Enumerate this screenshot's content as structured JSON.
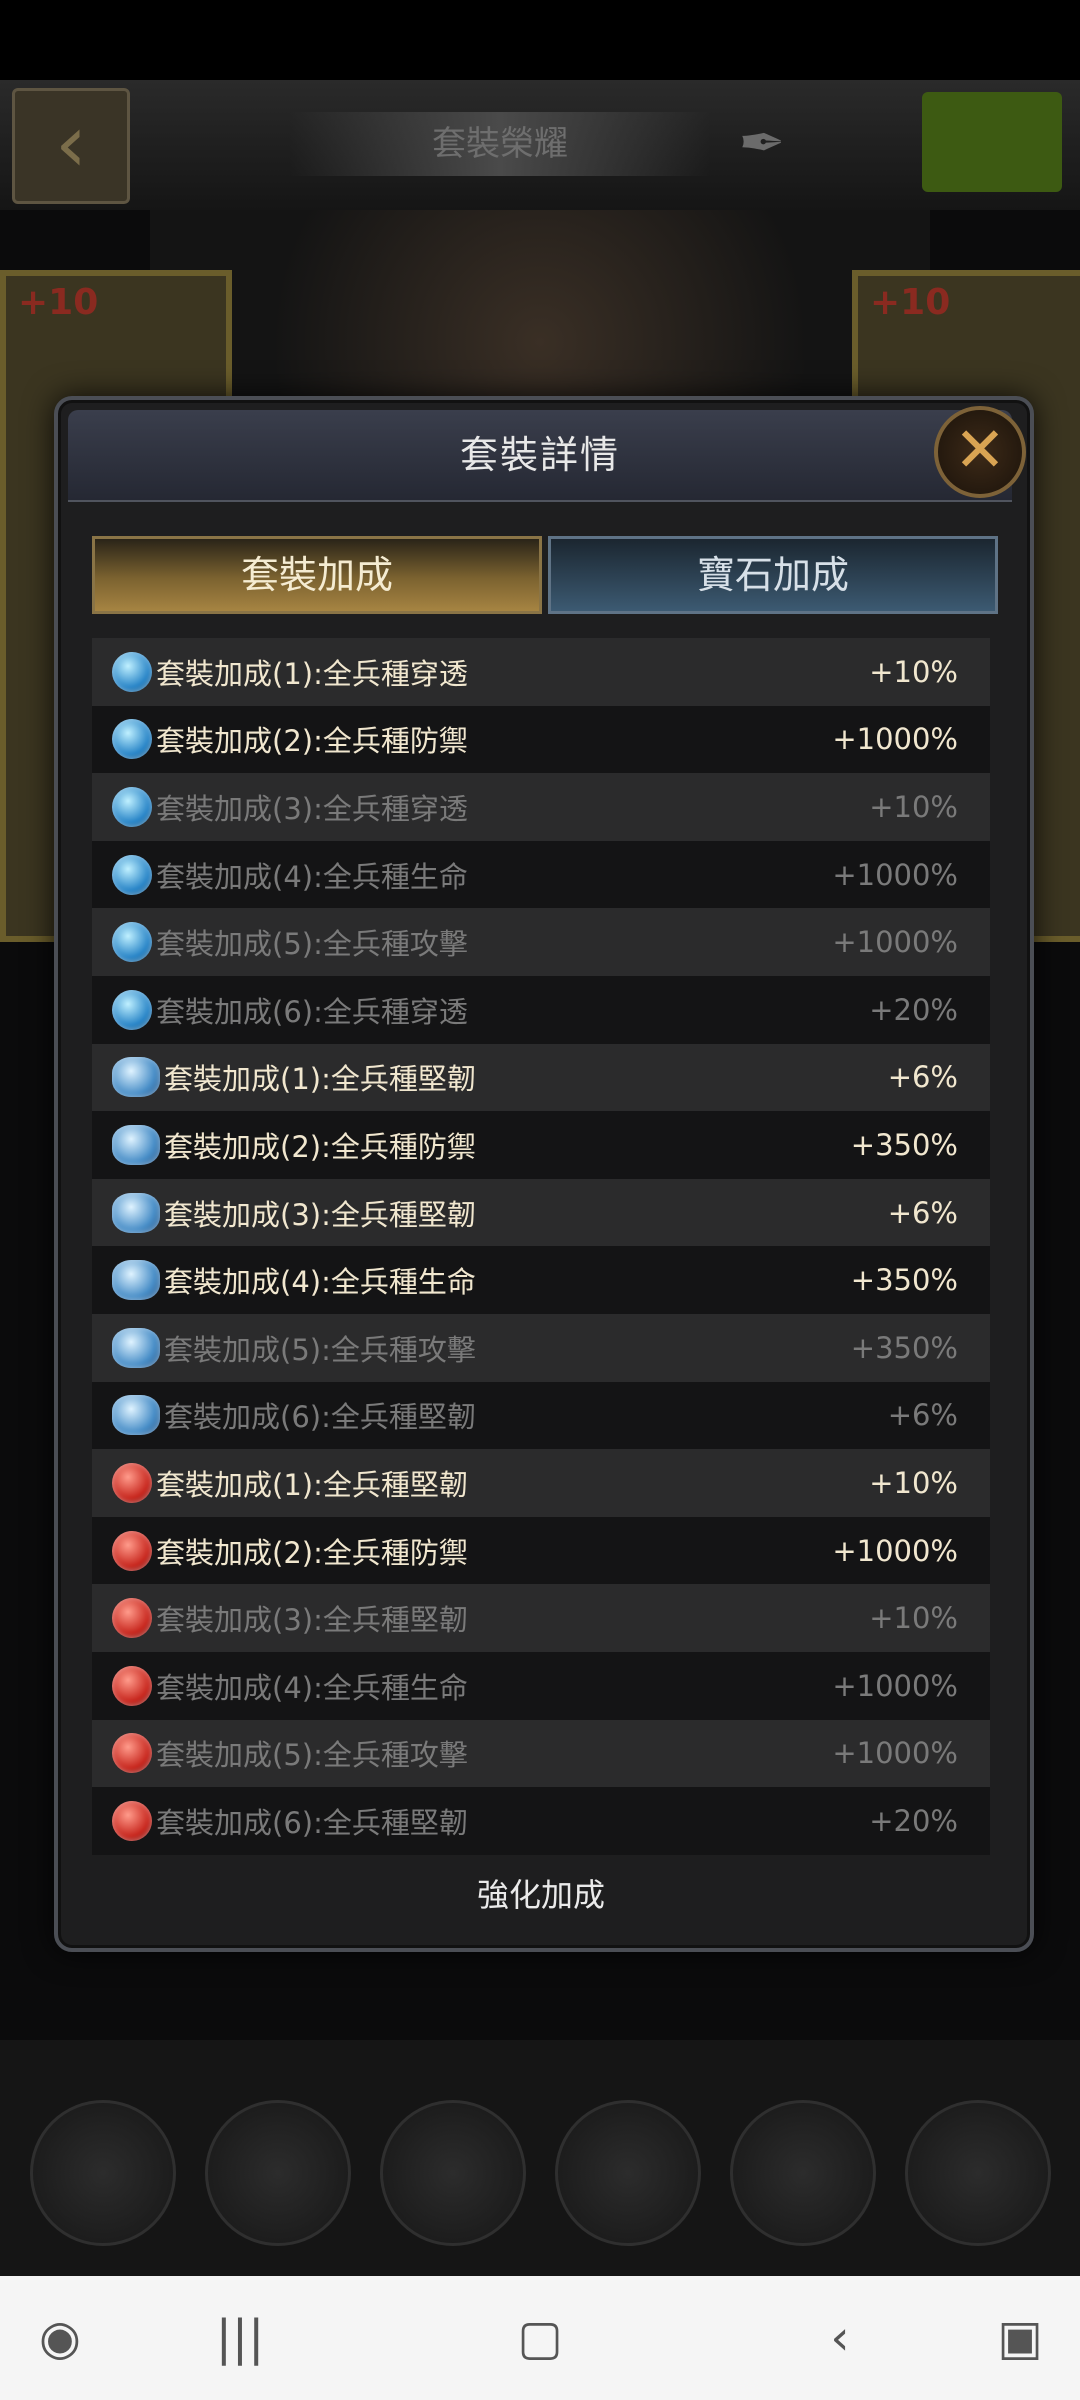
{
  "background": {
    "title_plate": "套裝榮耀",
    "left_card_level": "+10",
    "right_card_level": "+10"
  },
  "dialog": {
    "title": "套裝詳情",
    "tabs": [
      "套裝加成",
      "寶石加成"
    ],
    "active_tab": "套裝加成",
    "rows": [
      {
        "gem": "blue",
        "label": "套裝加成(1):全兵種穿透",
        "value": "+10%",
        "active": true
      },
      {
        "gem": "blue",
        "label": "套裝加成(2):全兵種防禦",
        "value": "+1000%",
        "active": true
      },
      {
        "gem": "blue",
        "label": "套裝加成(3):全兵種穿透",
        "value": "+10%",
        "active": false
      },
      {
        "gem": "blue",
        "label": "套裝加成(4):全兵種生命",
        "value": "+1000%",
        "active": false
      },
      {
        "gem": "blue",
        "label": "套裝加成(5):全兵種攻擊",
        "value": "+1000%",
        "active": false
      },
      {
        "gem": "blue",
        "label": "套裝加成(6):全兵種穿透",
        "value": "+20%",
        "active": false
      },
      {
        "gem": "cloud",
        "label": "套裝加成(1):全兵種堅韌",
        "value": "+6%",
        "active": true
      },
      {
        "gem": "cloud",
        "label": "套裝加成(2):全兵種防禦",
        "value": "+350%",
        "active": true
      },
      {
        "gem": "cloud",
        "label": "套裝加成(3):全兵種堅韌",
        "value": "+6%",
        "active": true
      },
      {
        "gem": "cloud",
        "label": "套裝加成(4):全兵種生命",
        "value": "+350%",
        "active": true
      },
      {
        "gem": "cloud",
        "label": "套裝加成(5):全兵種攻擊",
        "value": "+350%",
        "active": false
      },
      {
        "gem": "cloud",
        "label": "套裝加成(6):全兵種堅韌",
        "value": "+6%",
        "active": false
      },
      {
        "gem": "red",
        "label": "套裝加成(1):全兵種堅韌",
        "value": "+10%",
        "active": true
      },
      {
        "gem": "red",
        "label": "套裝加成(2):全兵種防禦",
        "value": "+1000%",
        "active": true
      },
      {
        "gem": "red",
        "label": "套裝加成(3):全兵種堅韌",
        "value": "+10%",
        "active": false
      },
      {
        "gem": "red",
        "label": "套裝加成(4):全兵種生命",
        "value": "+1000%",
        "active": false
      },
      {
        "gem": "red",
        "label": "套裝加成(5):全兵種攻擊",
        "value": "+1000%",
        "active": false
      },
      {
        "gem": "red",
        "label": "套裝加成(6):全兵種堅韌",
        "value": "+20%",
        "active": false
      }
    ],
    "footer_label": "強化加成"
  },
  "navbar": {
    "icons": [
      "game-launcher-icon",
      "recent-apps-icon",
      "home-icon",
      "back-icon",
      "screenshot-icon"
    ]
  },
  "colors": {
    "active_text": "#f1e7cf",
    "inactive_text": "#7a7a7a",
    "tab_active": "#a68442",
    "tab_inactive": "#3c5a72"
  }
}
